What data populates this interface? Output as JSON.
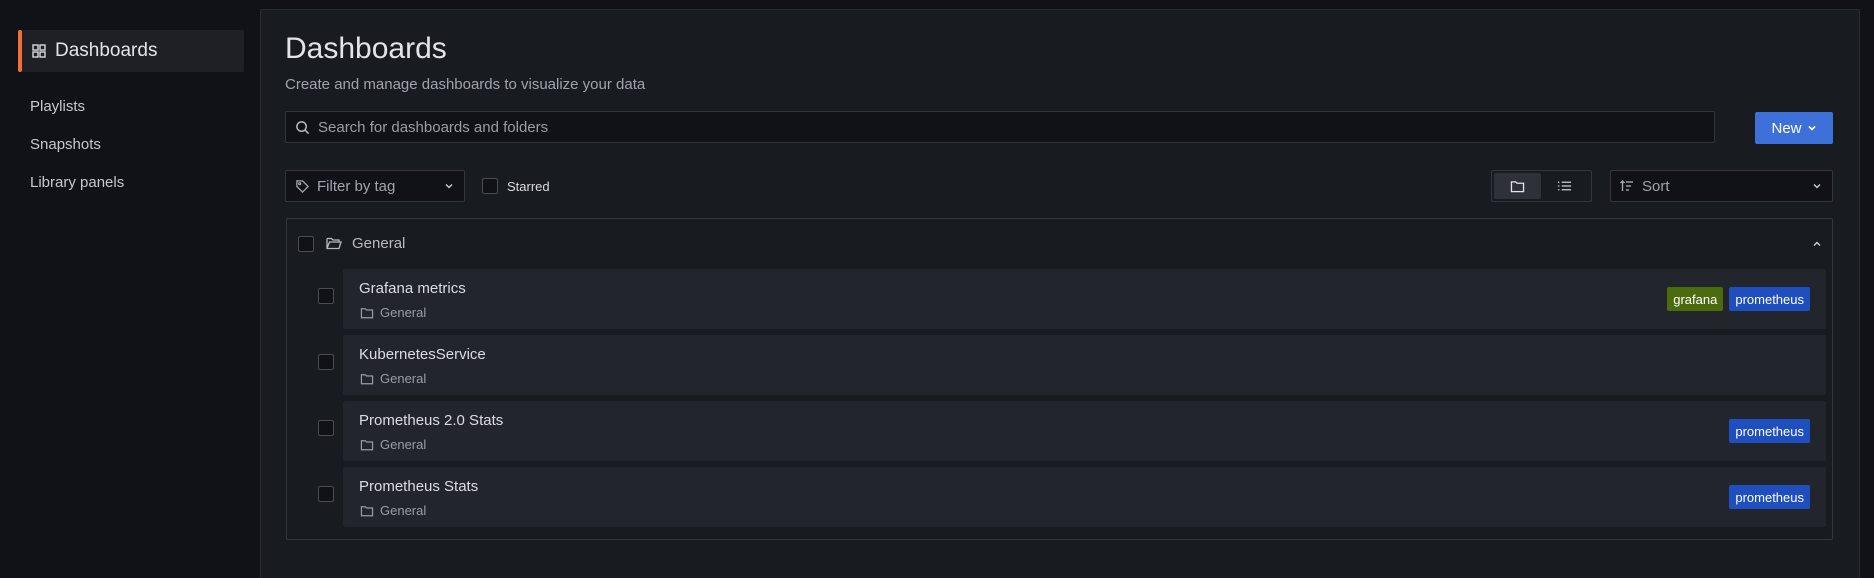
{
  "sidebar": {
    "active": "Dashboards",
    "items": [
      "Playlists",
      "Snapshots",
      "Library panels"
    ]
  },
  "main": {
    "title": "Dashboards",
    "subtitle": "Create and manage dashboards to visualize your data",
    "search_placeholder": "Search for dashboards and folders",
    "new_label": "New",
    "filter_placeholder": "Filter by tag",
    "starred_label": "Starred",
    "sort_placeholder": "Sort"
  },
  "folder": {
    "name": "General",
    "dashboards": [
      {
        "name": "Grafana metrics",
        "folder": "General",
        "tags": [
          "grafana",
          "prometheus"
        ]
      },
      {
        "name": "KubernetesService",
        "folder": "General",
        "tags": []
      },
      {
        "name": "Prometheus 2.0 Stats",
        "folder": "General",
        "tags": [
          "prometheus"
        ]
      },
      {
        "name": "Prometheus Stats",
        "folder": "General",
        "tags": [
          "prometheus"
        ]
      }
    ]
  },
  "colors": {
    "accent": "#f46e37",
    "primary_button": "#3d71d9",
    "tag_grafana": "#4b6b0f",
    "tag_prometheus": "#1f4fbf"
  }
}
